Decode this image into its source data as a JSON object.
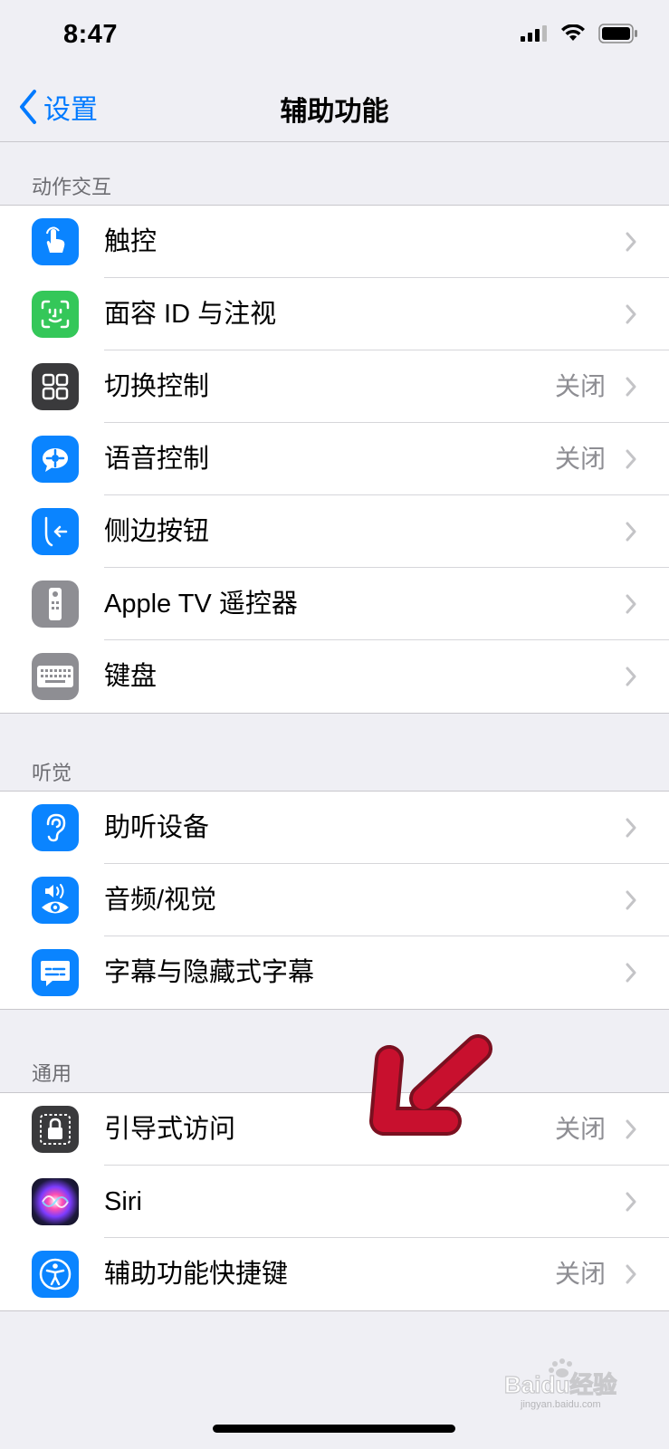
{
  "status": {
    "time": "8:47"
  },
  "nav": {
    "back_label": "设置",
    "title": "辅助功能"
  },
  "sections": [
    {
      "header": "动作交互",
      "rows": [
        {
          "label": "触控",
          "value": "",
          "icon": "hand-touch-icon",
          "color": "#0a84ff"
        },
        {
          "label": "面容 ID 与注视",
          "value": "",
          "icon": "face-id-icon",
          "color": "#34c759"
        },
        {
          "label": "切换控制",
          "value": "关闭",
          "icon": "switch-control-icon",
          "color": "#3a3a3c"
        },
        {
          "label": "语音控制",
          "value": "关闭",
          "icon": "voice-control-icon",
          "color": "#0a84ff"
        },
        {
          "label": "侧边按钮",
          "value": "",
          "icon": "side-button-icon",
          "color": "#0a84ff"
        },
        {
          "label": "Apple TV 遥控器",
          "value": "",
          "icon": "tv-remote-icon",
          "color": "#8e8e93"
        },
        {
          "label": "键盘",
          "value": "",
          "icon": "keyboard-icon",
          "color": "#8e8e93"
        }
      ]
    },
    {
      "header": "听觉",
      "rows": [
        {
          "label": "助听设备",
          "value": "",
          "icon": "ear-icon",
          "color": "#0a84ff"
        },
        {
          "label": "音频/视觉",
          "value": "",
          "icon": "audio-visual-icon",
          "color": "#0a84ff"
        },
        {
          "label": "字幕与隐藏式字幕",
          "value": "",
          "icon": "subtitles-icon",
          "color": "#0a84ff"
        }
      ]
    },
    {
      "header": "通用",
      "rows": [
        {
          "label": "引导式访问",
          "value": "关闭",
          "icon": "guided-access-icon",
          "color": "#3a3a3c"
        },
        {
          "label": "Siri",
          "value": "",
          "icon": "siri-icon",
          "color": "#1e1a3e"
        },
        {
          "label": "辅助功能快捷键",
          "value": "关闭",
          "icon": "accessibility-icon",
          "color": "#0a84ff"
        }
      ]
    }
  ],
  "watermark": {
    "text": "Baidu经验",
    "subtext": "jingyan.baidu.com"
  }
}
